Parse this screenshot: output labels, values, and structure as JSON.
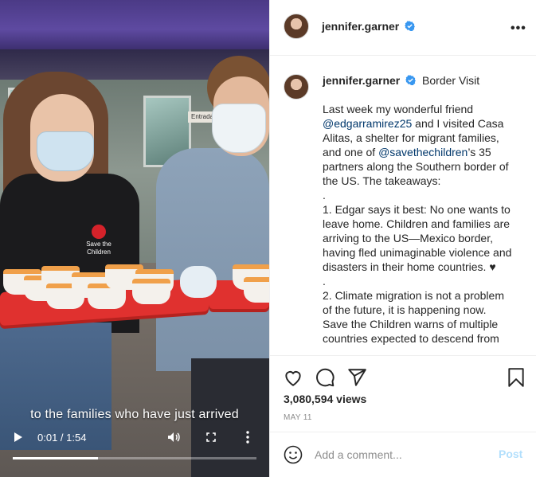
{
  "video": {
    "caption": "to the families who have just arrived",
    "time_display": "0:01 / 1:54",
    "progress": 0.35,
    "storefront_sign": "Entrada",
    "shirt_logo_text": "Save the Children"
  },
  "header": {
    "username": "jennifer.garner",
    "verified": true,
    "more_icon": "more-horizontal-icon"
  },
  "caption": {
    "username": "jennifer.garner",
    "location": "Border Visit",
    "paragraphs": [
      [
        "Last week my wonderful friend ",
        "@edgarramirez25",
        " and I visited Casa Alitas, a shelter for migrant families, and one of ",
        "@savethechildren",
        "’s 35 partners along the Southern border of the US. The takeaways:"
      ],
      [
        "."
      ],
      [
        "1. Edgar says it best: No one wants to leave home. Children and families are arriving to the US—Mexico border, having fled unimaginable violence and disasters in their home countries. ♥"
      ],
      [
        "."
      ],
      [
        "2. Climate migration is not a problem of the future, it is happening now. Save the Children warns of multiple countries expected to descend from"
      ]
    ]
  },
  "actions": {
    "icons": [
      "heart-icon",
      "comment-icon",
      "share-icon",
      "bookmark-icon"
    ],
    "views": "3,080,594 views",
    "date": "MAY 11"
  },
  "comment": {
    "placeholder": "Add a comment...",
    "post_label": "Post"
  },
  "colors": {
    "mention": "#00376b",
    "verified": "#3897f0",
    "post_disabled": "#b2dffc",
    "tray": "#e0312f"
  }
}
